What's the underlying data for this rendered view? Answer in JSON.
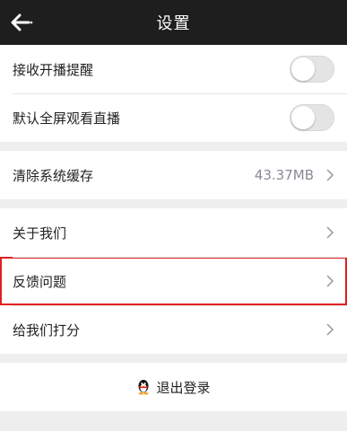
{
  "header": {
    "title": "设置",
    "back_icon": "back-arrow-icon"
  },
  "notifications": {
    "live_alert_label": "接收开播提醒",
    "fullscreen_label": "默认全屏观看直播"
  },
  "cache": {
    "label": "清除系统缓存",
    "size": "43.37MB"
  },
  "about": {
    "about_label": "关于我们",
    "feedback_label": "反馈问题",
    "rate_label": "给我们打分"
  },
  "logout": {
    "label": "退出登录",
    "icon": "qq-penguin-icon"
  },
  "colors": {
    "header_bg": "#1e1e1e",
    "highlight": "#e02020"
  }
}
